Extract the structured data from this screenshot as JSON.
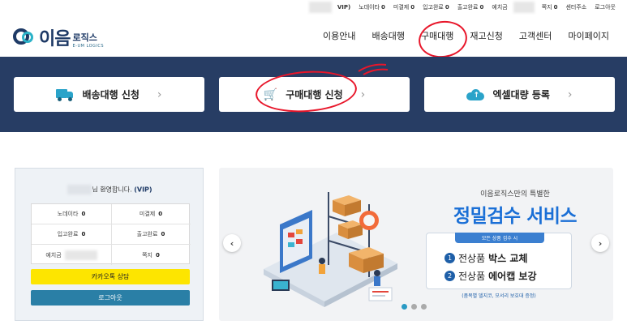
{
  "util_bar": {
    "vip_label": "VIP)",
    "items": [
      {
        "label": "노데이타",
        "value": "0"
      },
      {
        "label": "미결제",
        "value": "0"
      },
      {
        "label": "입고완료",
        "value": "0"
      },
      {
        "label": "출고완료",
        "value": "0"
      }
    ],
    "deposit_label": "예치금",
    "memo": {
      "label": "쪽지",
      "value": "0"
    },
    "center_address": "센터주소",
    "logout": "로그아웃"
  },
  "logo": {
    "mark": "이음",
    "name_ko": "로직스",
    "name_en": "E-UM LOGICS"
  },
  "nav": [
    "이용안내",
    "배송대행",
    "구매대행",
    "재고신청",
    "고객센터",
    "마이페이지"
  ],
  "quick": [
    {
      "label": "배송대행 신청",
      "icon": "truck-icon"
    },
    {
      "label": "구매대행 신청",
      "icon": "cart-icon"
    },
    {
      "label": "엑셀대량 등록",
      "icon": "cloud-upload-icon"
    }
  ],
  "panel": {
    "welcome_suffix": "님 환영합니다.",
    "vip": "(VIP)",
    "stats": [
      {
        "label": "노데이타",
        "value": "0"
      },
      {
        "label": "미결제",
        "value": "0"
      },
      {
        "label": "입고완료",
        "value": "0"
      },
      {
        "label": "출고완료",
        "value": "0"
      },
      {
        "label": "예치금",
        "value": ""
      },
      {
        "label": "쪽지",
        "value": "0"
      }
    ],
    "kakao": "카카오톡 상담",
    "logout": "로그아웃"
  },
  "slider": {
    "subtitle": "이음로직스만의 특별한",
    "title": "정밀검수 서비스",
    "pill": "모든 상품 검수 시",
    "lines": [
      {
        "num": "1",
        "pre": "전상품 ",
        "bold": "박스 교체"
      },
      {
        "num": "2",
        "pre": "전상품 ",
        "bold": "에어캡 보강"
      }
    ],
    "note": "(품목별 델지코, 모서리 보호대 증정)",
    "prev": "‹",
    "next": "›",
    "active_dot": 0,
    "dot_count": 3
  },
  "colors": {
    "band": "#273d64",
    "accent": "#2aa3c9",
    "title_blue": "#1a6fd6",
    "annotation_red": "#e8162a",
    "kakao_yellow": "#fde500"
  }
}
